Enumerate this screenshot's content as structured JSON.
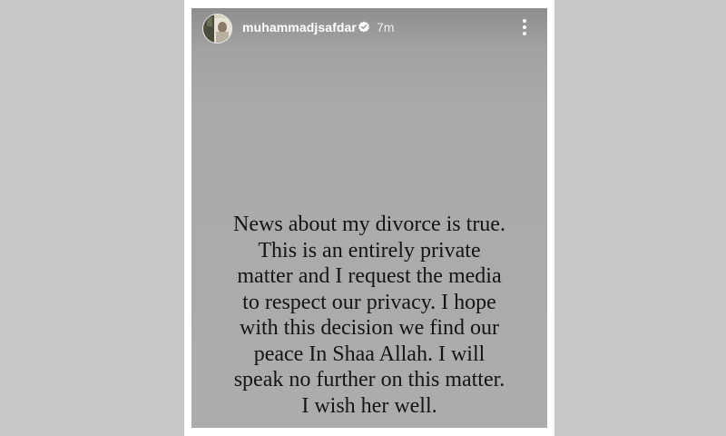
{
  "story": {
    "username": "muhammadjsafdar",
    "verified_icon": "verified-badge-icon",
    "time_ago": "7m",
    "more_icon": "more-options-icon",
    "message_lines": [
      "News about my divorce is true.",
      "This is an entirely private",
      "matter and I request the media",
      "to respect our privacy. I hope",
      "with this decision we find our",
      "peace In Shaa Allah. I will",
      "speak no further on this matter.",
      "I wish her well."
    ]
  }
}
